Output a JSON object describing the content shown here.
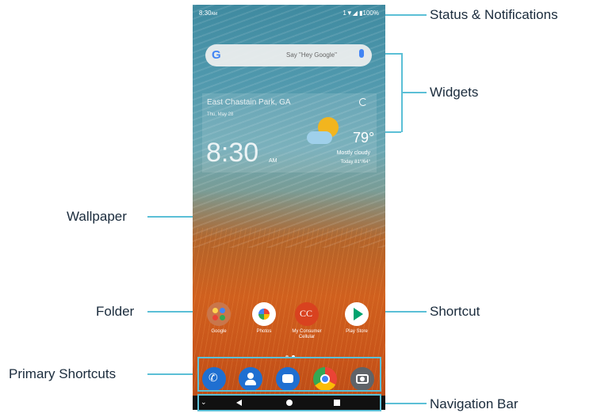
{
  "status_bar": {
    "time": "8:30",
    "time_suffix": "AM",
    "right": "1▼◢ ▮100%"
  },
  "search_widget": {
    "logo": "G",
    "placeholder": "Say \"Hey Google\"",
    "icon": "mic-icon"
  },
  "weather_widget": {
    "location": "East Chastain Park, GA",
    "date": "Thu, May 28",
    "time": "8:30",
    "ampm": "AM",
    "temperature": "79°",
    "condition": "Mostly cloudy",
    "hilo": "Today 81°/64°"
  },
  "home_apps": [
    {
      "label": "Google",
      "icon": "google-folder-icon",
      "color": "#c9764b"
    },
    {
      "label": "Photos",
      "icon": "photos-icon",
      "color": "#ffffff"
    },
    {
      "label": "My Consumer Cellular",
      "icon": "cc-icon",
      "color": "#d9421f"
    },
    {
      "label": "Play Store",
      "icon": "play-store-icon",
      "color": "#ffffff"
    }
  ],
  "dock_apps": [
    {
      "name": "Phone",
      "icon": "phone-icon",
      "color": "#1f6fd1"
    },
    {
      "name": "Contacts",
      "icon": "contacts-icon",
      "color": "#1f6fd1"
    },
    {
      "name": "Messages",
      "icon": "messages-icon",
      "color": "#1f6fd1"
    },
    {
      "name": "Chrome",
      "icon": "chrome-icon",
      "color": "#ffffff"
    },
    {
      "name": "Camera",
      "icon": "camera-icon",
      "color": "#5f6368"
    }
  ],
  "nav_bar": {
    "icons": [
      "collapse-icon",
      "back-icon",
      "home-icon",
      "recents-icon"
    ]
  },
  "callouts": {
    "status": "Status & Notifications",
    "widgets": "Widgets",
    "wallpaper": "Wallpaper",
    "folder": "Folder",
    "shortcut": "Shortcut",
    "primary": "Primary Shortcuts",
    "navigation": "Navigation Bar"
  },
  "colors": {
    "callout_line": "#5bbfd6",
    "callout_text": "#1a2b3c"
  }
}
